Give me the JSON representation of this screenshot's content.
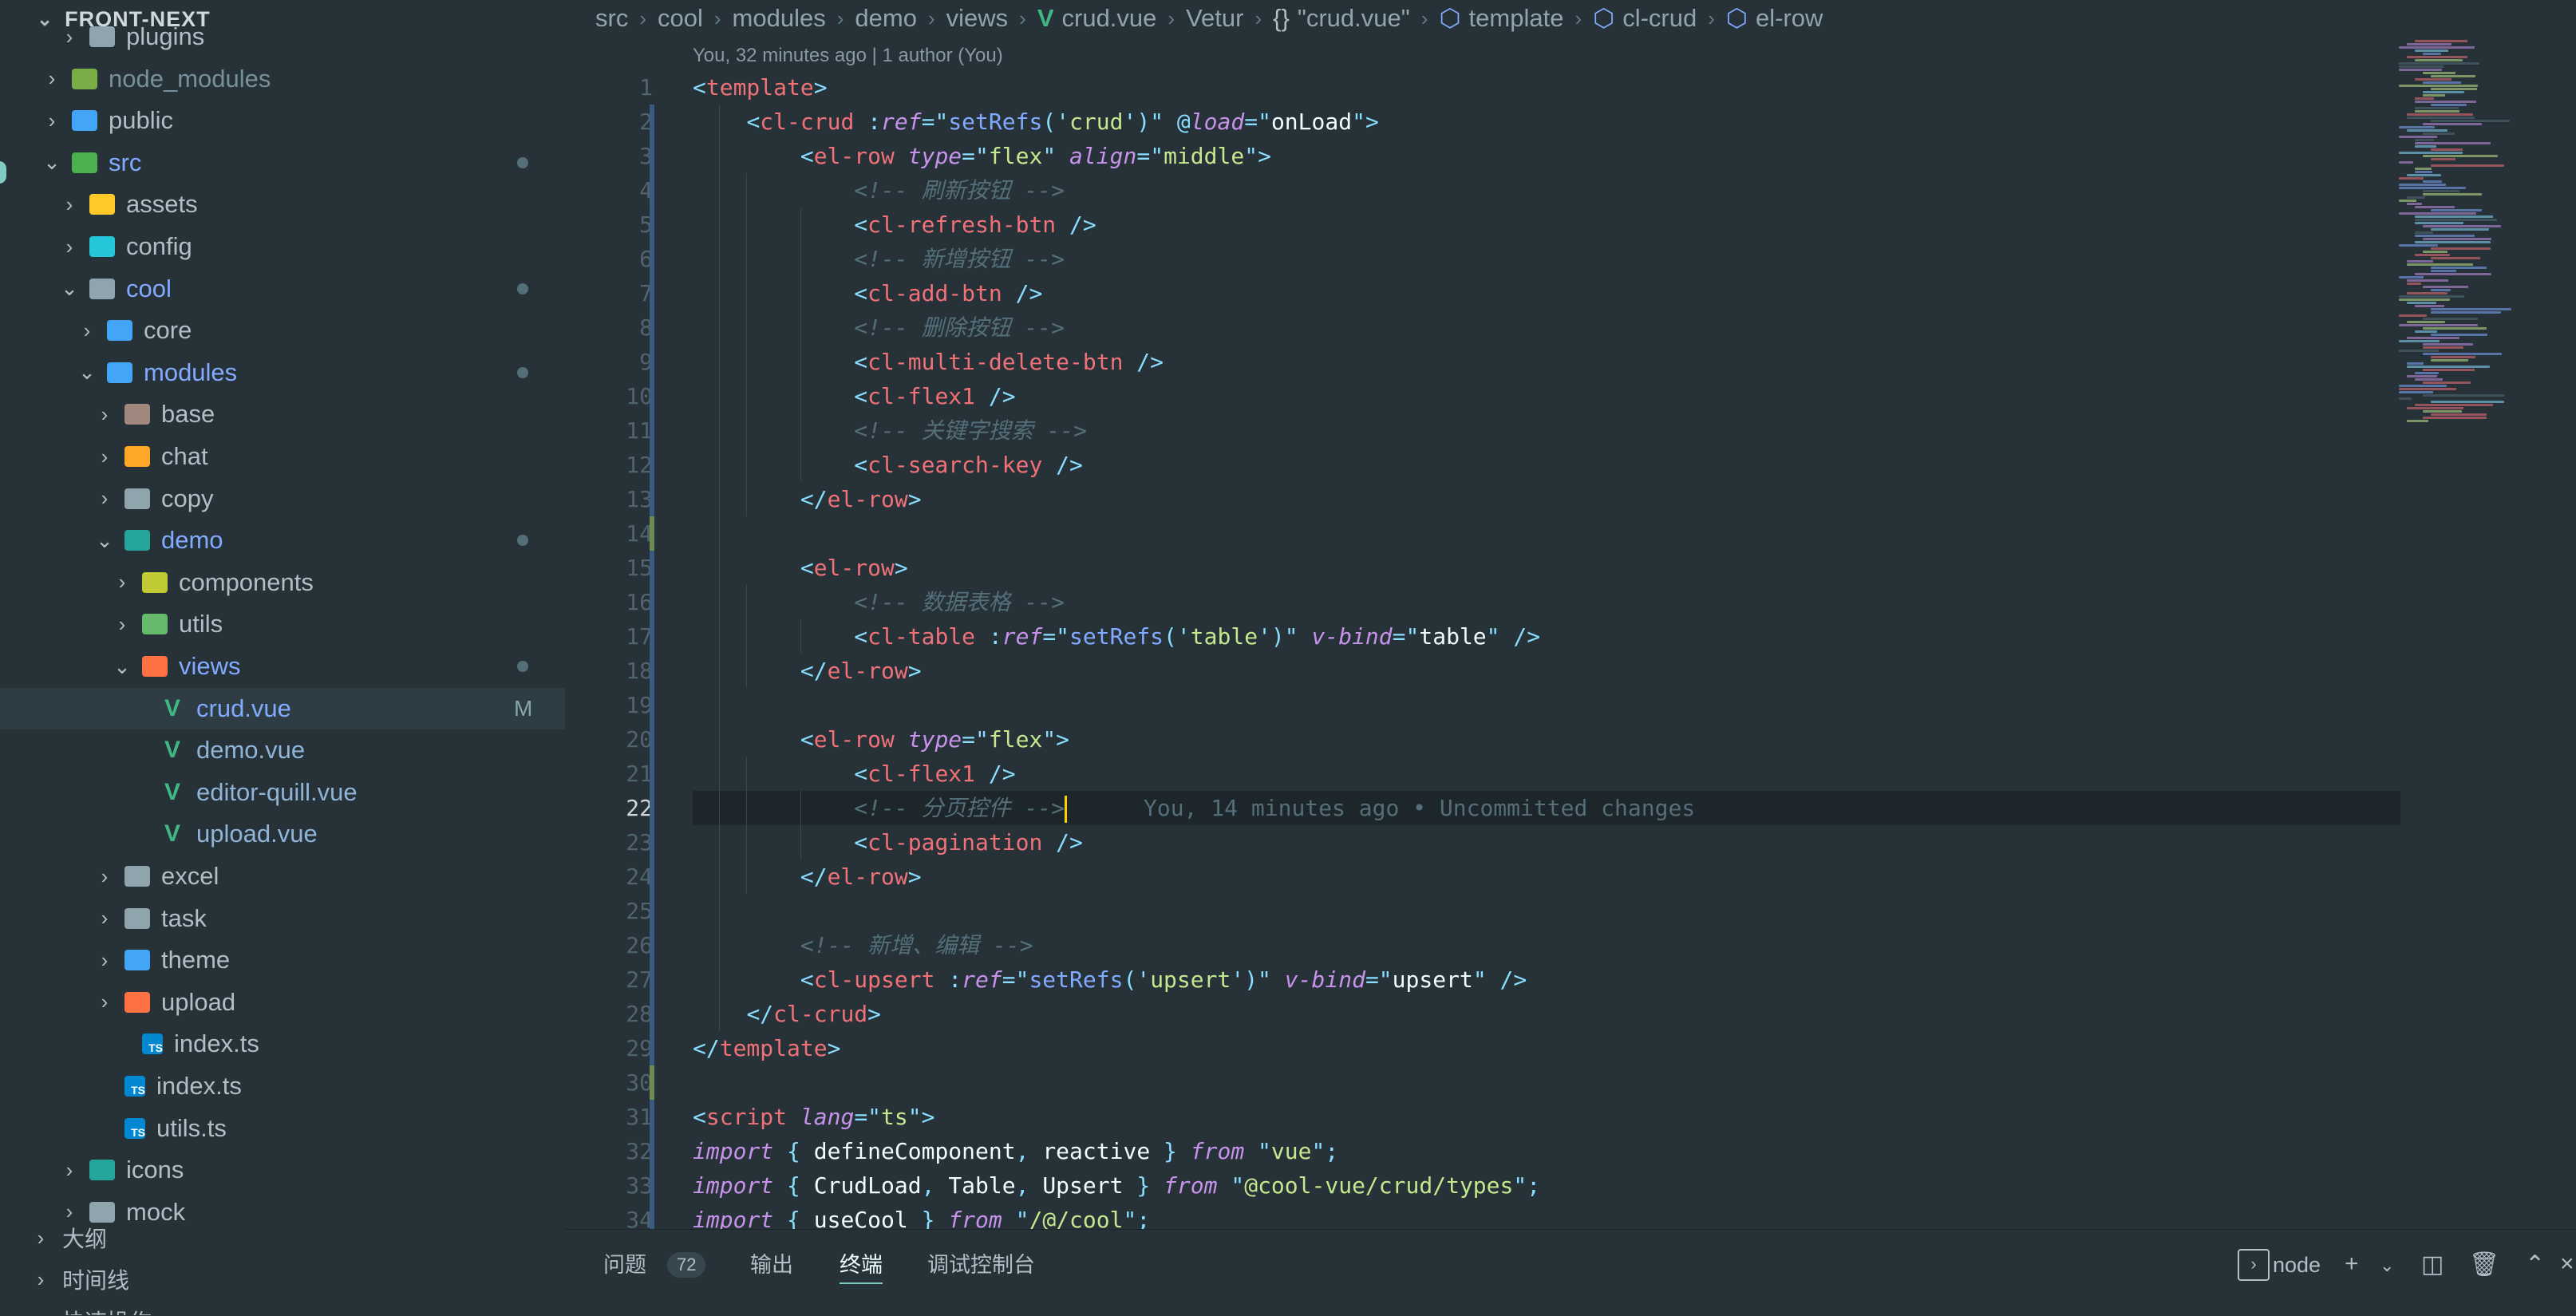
{
  "explorer": {
    "title": "FRONT-NEXT",
    "items": [
      {
        "label": "plugins",
        "depth": 2,
        "type": "folder",
        "color": "#90a4ae",
        "open": false
      },
      {
        "label": "node_modules",
        "depth": 1,
        "type": "folder",
        "color": "#8bc34a",
        "open": false
      },
      {
        "label": "public",
        "depth": 1,
        "type": "folder",
        "color": "#42a5f5",
        "open": false
      },
      {
        "label": "src",
        "depth": 1,
        "type": "folder",
        "color": "#4caf50",
        "open": true,
        "dot": true
      },
      {
        "label": "assets",
        "depth": 2,
        "type": "folder",
        "color": "#ffca28",
        "open": false
      },
      {
        "label": "config",
        "depth": 2,
        "type": "folder",
        "color": "#26c6da",
        "open": false
      },
      {
        "label": "cool",
        "depth": 2,
        "type": "folder",
        "color": "#90a4ae",
        "open": true,
        "dot": true
      },
      {
        "label": "core",
        "depth": 3,
        "type": "folder",
        "color": "#42a5f5",
        "open": false
      },
      {
        "label": "modules",
        "depth": 3,
        "type": "folder",
        "color": "#42a5f5",
        "open": true,
        "dot": true
      },
      {
        "label": "base",
        "depth": 4,
        "type": "folder",
        "color": "#a1887f",
        "open": false
      },
      {
        "label": "chat",
        "depth": 4,
        "type": "folder",
        "color": "#ffa726",
        "open": false
      },
      {
        "label": "copy",
        "depth": 4,
        "type": "folder",
        "color": "#90a4ae",
        "open": false
      },
      {
        "label": "demo",
        "depth": 4,
        "type": "folder",
        "color": "#26a69a",
        "open": true,
        "dot": true
      },
      {
        "label": "components",
        "depth": 5,
        "type": "folder",
        "color": "#c0ca33",
        "open": false
      },
      {
        "label": "utils",
        "depth": 5,
        "type": "folder",
        "color": "#66bb6a",
        "open": false
      },
      {
        "label": "views",
        "depth": 5,
        "type": "folder",
        "color": "#ff7043",
        "open": true,
        "dot": true
      },
      {
        "label": "crud.vue",
        "depth": 6,
        "type": "vue",
        "color": "#41b883",
        "status": "M",
        "active": true
      },
      {
        "label": "demo.vue",
        "depth": 6,
        "type": "vue",
        "color": "#41b883"
      },
      {
        "label": "editor-quill.vue",
        "depth": 6,
        "type": "vue",
        "color": "#41b883"
      },
      {
        "label": "upload.vue",
        "depth": 6,
        "type": "vue",
        "color": "#41b883"
      },
      {
        "label": "excel",
        "depth": 4,
        "type": "folder",
        "color": "#90a4ae",
        "open": false
      },
      {
        "label": "task",
        "depth": 4,
        "type": "folder",
        "color": "#90a4ae",
        "open": false
      },
      {
        "label": "theme",
        "depth": 4,
        "type": "folder",
        "color": "#42a5f5",
        "open": false
      },
      {
        "label": "upload",
        "depth": 4,
        "type": "folder",
        "color": "#ff7043",
        "open": false
      },
      {
        "label": "index.ts",
        "depth": 5,
        "type": "ts",
        "color": "#0288d1"
      },
      {
        "label": "index.ts",
        "depth": 4,
        "type": "ts",
        "color": "#0288d1"
      },
      {
        "label": "utils.ts",
        "depth": 4,
        "type": "ts",
        "color": "#0288d1"
      },
      {
        "label": "icons",
        "depth": 2,
        "type": "folder",
        "color": "#26a69a",
        "open": false
      },
      {
        "label": "mock",
        "depth": 2,
        "type": "folder",
        "color": "#90a4ae",
        "open": false
      }
    ],
    "panels": [
      "大纲",
      "时间线",
      "快速操作"
    ]
  },
  "breadcrumbs": [
    "src",
    "cool",
    "modules",
    "demo",
    "views",
    "crud.vue",
    "Vetur",
    "\"crud.vue\"",
    "template",
    "cl-crud",
    "el-row"
  ],
  "codelens": "You, 32 minutes ago | 1 author (You)",
  "editor": {
    "current_line": 22,
    "blame": "You, 14 minutes ago • Uncommitted changes",
    "lines": [
      [
        [
          "<",
          "p"
        ],
        [
          "template",
          "t"
        ],
        [
          ">",
          "p"
        ]
      ],
      [
        [
          "    ",
          "w"
        ],
        [
          "<",
          "p"
        ],
        [
          "cl-crud",
          "t"
        ],
        [
          " :",
          "p"
        ],
        [
          "ref",
          "a"
        ],
        [
          "=\"",
          "p"
        ],
        [
          "setRefs",
          "f"
        ],
        [
          "('",
          "p"
        ],
        [
          "crud",
          "s"
        ],
        [
          "')\"",
          "p"
        ],
        [
          " @",
          "p"
        ],
        [
          "load",
          "a"
        ],
        [
          "=\"",
          "p"
        ],
        [
          "onLoad",
          "w"
        ],
        [
          "\">",
          "p"
        ]
      ],
      [
        [
          "        ",
          "w"
        ],
        [
          "<",
          "p"
        ],
        [
          "el-row",
          "t"
        ],
        [
          " ",
          "w"
        ],
        [
          "type",
          "a"
        ],
        [
          "=\"",
          "p"
        ],
        [
          "flex",
          "s"
        ],
        [
          "\" ",
          "p"
        ],
        [
          "align",
          "a"
        ],
        [
          "=\"",
          "p"
        ],
        [
          "middle",
          "s"
        ],
        [
          "\">",
          "p"
        ]
      ],
      [
        [
          "            ",
          "w"
        ],
        [
          "<!-- 刷新按钮 -->",
          "c"
        ]
      ],
      [
        [
          "            ",
          "w"
        ],
        [
          "<",
          "p"
        ],
        [
          "cl-refresh-btn",
          "t"
        ],
        [
          " />",
          "p"
        ]
      ],
      [
        [
          "            ",
          "w"
        ],
        [
          "<!-- 新增按钮 -->",
          "c"
        ]
      ],
      [
        [
          "            ",
          "w"
        ],
        [
          "<",
          "p"
        ],
        [
          "cl-add-btn",
          "t"
        ],
        [
          " />",
          "p"
        ]
      ],
      [
        [
          "            ",
          "w"
        ],
        [
          "<!-- 删除按钮 -->",
          "c"
        ]
      ],
      [
        [
          "            ",
          "w"
        ],
        [
          "<",
          "p"
        ],
        [
          "cl-multi-delete-btn",
          "t"
        ],
        [
          " />",
          "p"
        ]
      ],
      [
        [
          "            ",
          "w"
        ],
        [
          "<",
          "p"
        ],
        [
          "cl-flex1",
          "t"
        ],
        [
          " />",
          "p"
        ]
      ],
      [
        [
          "            ",
          "w"
        ],
        [
          "<!-- 关键字搜索 -->",
          "c"
        ]
      ],
      [
        [
          "            ",
          "w"
        ],
        [
          "<",
          "p"
        ],
        [
          "cl-search-key",
          "t"
        ],
        [
          " />",
          "p"
        ]
      ],
      [
        [
          "        ",
          "w"
        ],
        [
          "</",
          "p"
        ],
        [
          "el-row",
          "t"
        ],
        [
          ">",
          "p"
        ]
      ],
      [],
      [
        [
          "        ",
          "w"
        ],
        [
          "<",
          "p"
        ],
        [
          "el-row",
          "t"
        ],
        [
          ">",
          "p"
        ]
      ],
      [
        [
          "            ",
          "w"
        ],
        [
          "<!-- 数据表格 -->",
          "c"
        ]
      ],
      [
        [
          "            ",
          "w"
        ],
        [
          "<",
          "p"
        ],
        [
          "cl-table",
          "t"
        ],
        [
          " :",
          "p"
        ],
        [
          "ref",
          "a"
        ],
        [
          "=\"",
          "p"
        ],
        [
          "setRefs",
          "f"
        ],
        [
          "('",
          "p"
        ],
        [
          "table",
          "s"
        ],
        [
          "')\"",
          "p"
        ],
        [
          " ",
          "w"
        ],
        [
          "v-bind",
          "a"
        ],
        [
          "=\"",
          "p"
        ],
        [
          "table",
          "w"
        ],
        [
          "\" />",
          "p"
        ]
      ],
      [
        [
          "        ",
          "w"
        ],
        [
          "</",
          "p"
        ],
        [
          "el-row",
          "t"
        ],
        [
          ">",
          "p"
        ]
      ],
      [],
      [
        [
          "        ",
          "w"
        ],
        [
          "<",
          "p"
        ],
        [
          "el-row",
          "t"
        ],
        [
          " ",
          "w"
        ],
        [
          "type",
          "a"
        ],
        [
          "=\"",
          "p"
        ],
        [
          "flex",
          "s"
        ],
        [
          "\">",
          "p"
        ]
      ],
      [
        [
          "            ",
          "w"
        ],
        [
          "<",
          "p"
        ],
        [
          "cl-flex1",
          "t"
        ],
        [
          " />",
          "p"
        ]
      ],
      [
        [
          "            ",
          "w"
        ],
        [
          "<!-- 分页控件 -->",
          "c"
        ]
      ],
      [
        [
          "            ",
          "w"
        ],
        [
          "<",
          "p"
        ],
        [
          "cl-pagination",
          "t"
        ],
        [
          " />",
          "p"
        ]
      ],
      [
        [
          "        ",
          "w"
        ],
        [
          "</",
          "p"
        ],
        [
          "el-row",
          "t"
        ],
        [
          ">",
          "p"
        ]
      ],
      [],
      [
        [
          "        ",
          "w"
        ],
        [
          "<!-- 新增、编辑 -->",
          "c"
        ]
      ],
      [
        [
          "        ",
          "w"
        ],
        [
          "<",
          "p"
        ],
        [
          "cl-upsert",
          "t"
        ],
        [
          " :",
          "p"
        ],
        [
          "ref",
          "a"
        ],
        [
          "=\"",
          "p"
        ],
        [
          "setRefs",
          "f"
        ],
        [
          "('",
          "p"
        ],
        [
          "upsert",
          "s"
        ],
        [
          "')\"",
          "p"
        ],
        [
          " ",
          "w"
        ],
        [
          "v-bind",
          "a"
        ],
        [
          "=\"",
          "p"
        ],
        [
          "upsert",
          "w"
        ],
        [
          "\" />",
          "p"
        ]
      ],
      [
        [
          "    ",
          "w"
        ],
        [
          "</",
          "p"
        ],
        [
          "cl-crud",
          "t"
        ],
        [
          ">",
          "p"
        ]
      ],
      [
        [
          "</",
          "p"
        ],
        [
          "template",
          "t"
        ],
        [
          ">",
          "p"
        ]
      ],
      [],
      [
        [
          "<",
          "p"
        ],
        [
          "script",
          "t"
        ],
        [
          " ",
          "w"
        ],
        [
          "lang",
          "a"
        ],
        [
          "=\"",
          "p"
        ],
        [
          "ts",
          "s"
        ],
        [
          "\">",
          "p"
        ]
      ],
      [
        [
          "import",
          "k"
        ],
        [
          " { ",
          "p"
        ],
        [
          "defineComponent",
          "w"
        ],
        [
          ", ",
          "p"
        ],
        [
          "reactive",
          "w"
        ],
        [
          " } ",
          "p"
        ],
        [
          "from",
          "k"
        ],
        [
          " \"",
          "p"
        ],
        [
          "vue",
          "s"
        ],
        [
          "\";",
          "p"
        ]
      ],
      [
        [
          "import",
          "k"
        ],
        [
          " { ",
          "p"
        ],
        [
          "CrudLoad",
          "w"
        ],
        [
          ", ",
          "p"
        ],
        [
          "Table",
          "w"
        ],
        [
          ", ",
          "p"
        ],
        [
          "Upsert",
          "w"
        ],
        [
          " } ",
          "p"
        ],
        [
          "from",
          "k"
        ],
        [
          " \"",
          "p"
        ],
        [
          "@cool-vue/crud/types",
          "s"
        ],
        [
          "\";",
          "p"
        ]
      ],
      [
        [
          "import",
          "k"
        ],
        [
          " { ",
          "p"
        ],
        [
          "useCool",
          "w"
        ],
        [
          " } ",
          "p"
        ],
        [
          "from",
          "k"
        ],
        [
          " \"",
          "p"
        ],
        [
          "/@/cool",
          "s"
        ],
        [
          "\";",
          "p"
        ]
      ]
    ]
  },
  "panel": {
    "tabs": [
      "问题",
      "输出",
      "终端",
      "调试控制台"
    ],
    "problems_count": "72",
    "active_tab": "终端",
    "terminal_name": "node"
  },
  "colors": {
    "background": "#263238",
    "accent": "#80cbc4",
    "cursor": "#ffcc00"
  }
}
